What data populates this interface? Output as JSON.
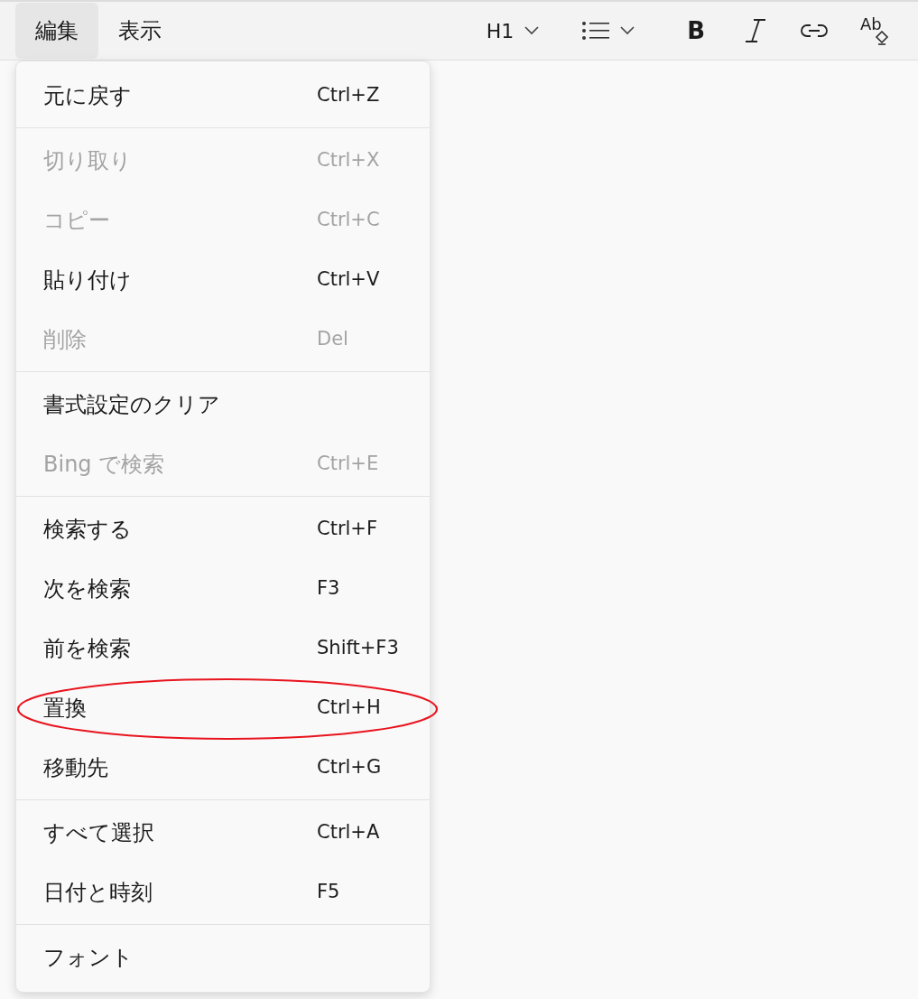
{
  "menubar": [
    {
      "label": "編集",
      "selected": true
    },
    {
      "label": "表示",
      "selected": false
    }
  ],
  "toolbar": {
    "heading": "H1",
    "bold": "B",
    "clear_format": "Ab"
  },
  "menu": {
    "groups": [
      [
        {
          "label": "元に戻す",
          "shortcut": "Ctrl+Z",
          "disabled": false,
          "circled": false
        }
      ],
      [
        {
          "label": "切り取り",
          "shortcut": "Ctrl+X",
          "disabled": true,
          "circled": false
        },
        {
          "label": "コピー",
          "shortcut": "Ctrl+C",
          "disabled": true,
          "circled": false
        },
        {
          "label": "貼り付け",
          "shortcut": "Ctrl+V",
          "disabled": false,
          "circled": false
        },
        {
          "label": "削除",
          "shortcut": "Del",
          "disabled": true,
          "circled": false
        }
      ],
      [
        {
          "label": "書式設定のクリア",
          "disabled": false,
          "circled": false
        },
        {
          "label": "Bing で検索",
          "shortcut": "Ctrl+E",
          "disabled": true,
          "circled": false
        }
      ],
      [
        {
          "label": "検索する",
          "shortcut": "Ctrl+F",
          "disabled": false,
          "circled": false
        },
        {
          "label": "次を検索",
          "shortcut": "F3",
          "disabled": false,
          "circled": false
        },
        {
          "label": "前を検索",
          "shortcut": "Shift+F3",
          "disabled": false,
          "circled": false
        },
        {
          "label": "置換",
          "shortcut": "Ctrl+H",
          "disabled": false,
          "circled": true
        },
        {
          "label": "移動先",
          "shortcut": "Ctrl+G",
          "disabled": false,
          "circled": false
        }
      ],
      [
        {
          "label": "すべて選択",
          "shortcut": "Ctrl+A",
          "disabled": false,
          "circled": false
        },
        {
          "label": "日付と時刻",
          "shortcut": "F5",
          "disabled": false,
          "circled": false
        }
      ],
      [
        {
          "label": "フォント",
          "disabled": false,
          "circled": false
        }
      ]
    ]
  }
}
